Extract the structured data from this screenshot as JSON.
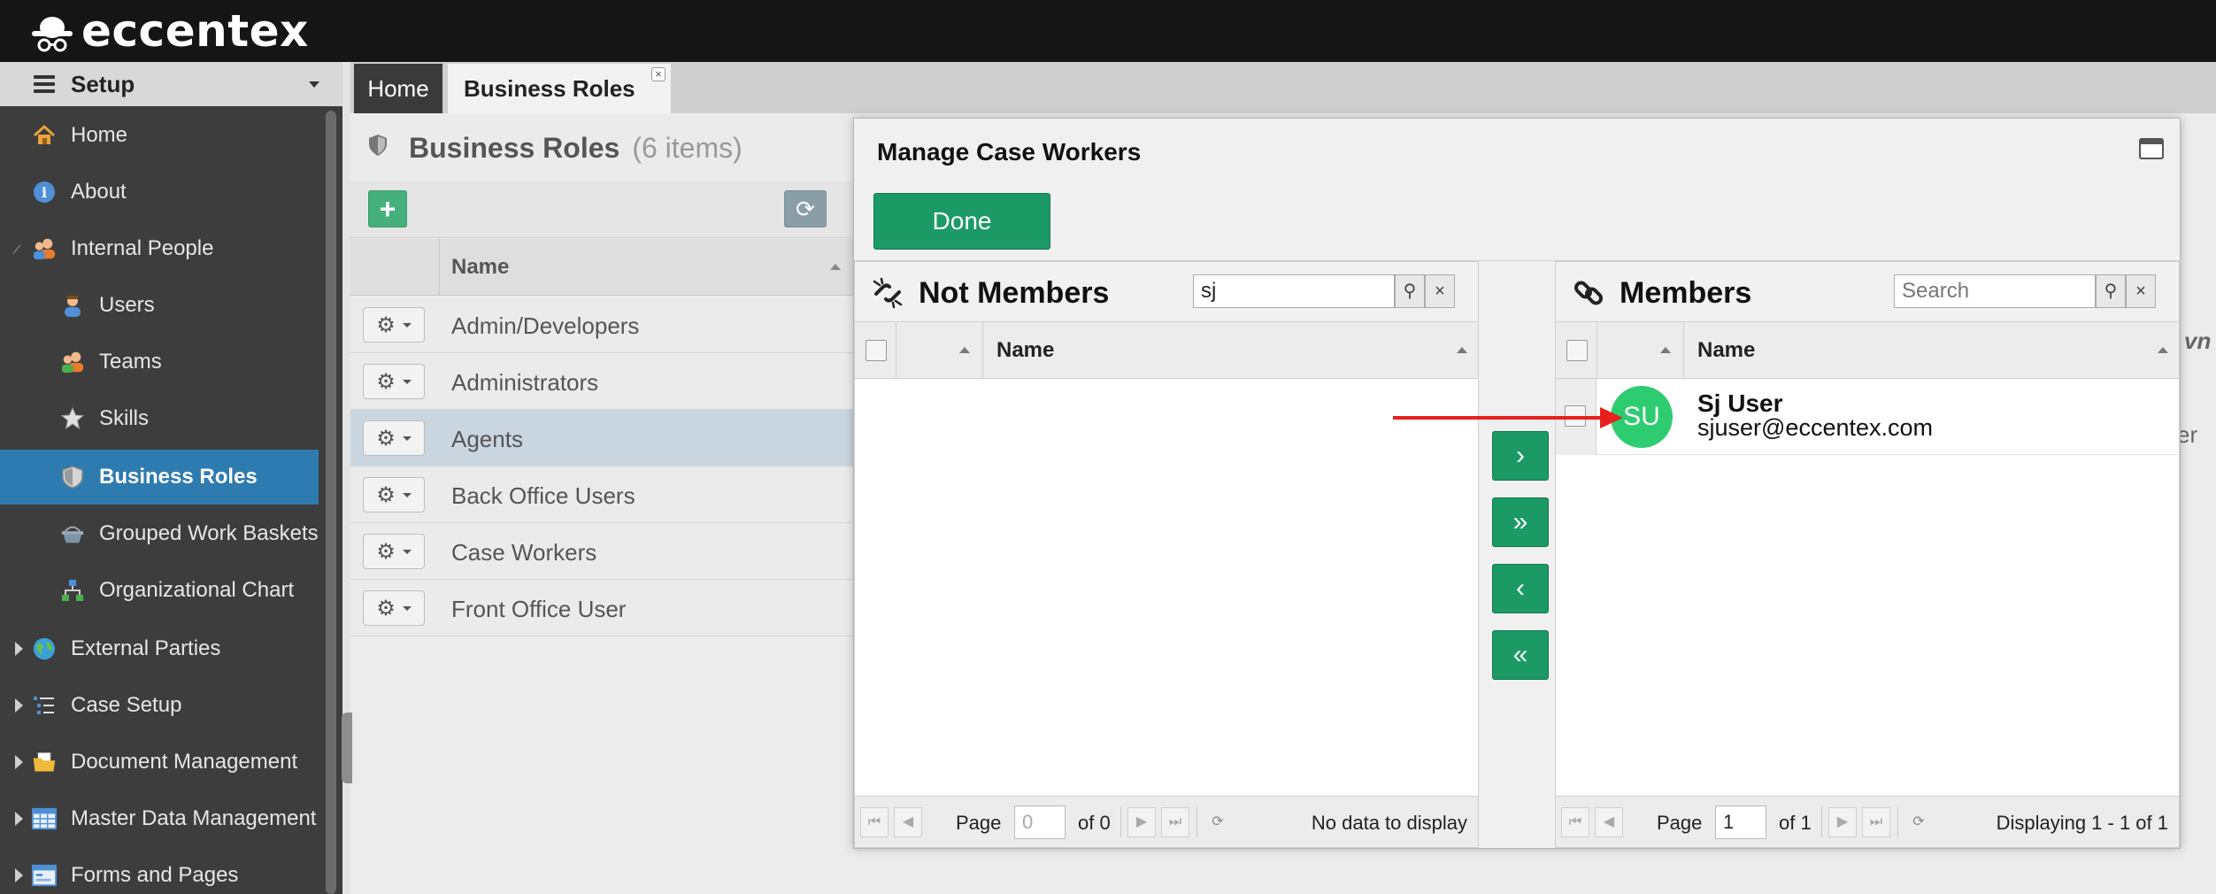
{
  "app": {
    "brand": "eccentex"
  },
  "sidebar": {
    "header": "Setup",
    "items": [
      {
        "label": "Home",
        "icon": "house-icon"
      },
      {
        "label": "About",
        "icon": "info-icon"
      },
      {
        "label": "Internal People",
        "icon": "people-icon"
      },
      {
        "label": "Users",
        "icon": "user-icon"
      },
      {
        "label": "Teams",
        "icon": "team-icon"
      },
      {
        "label": "Skills",
        "icon": "star-icon"
      },
      {
        "label": "Business Roles",
        "icon": "shield-icon"
      },
      {
        "label": "Grouped Work Baskets",
        "icon": "basket-icon"
      },
      {
        "label": "Organizational Chart",
        "icon": "org-chart-icon"
      },
      {
        "label": "External Parties",
        "icon": "globe-icon"
      },
      {
        "label": "Case Setup",
        "icon": "case-setup-icon"
      },
      {
        "label": "Document Management",
        "icon": "folder-icon"
      },
      {
        "label": "Master Data Management",
        "icon": "table-icon"
      },
      {
        "label": "Forms and Pages",
        "icon": "form-icon"
      }
    ]
  },
  "tabs": [
    {
      "label": "Home"
    },
    {
      "label": "Business Roles"
    }
  ],
  "roles_panel": {
    "title": "Business Roles",
    "count": "(6 items)",
    "column_name": "Name",
    "rows": [
      {
        "name": "Admin/Developers"
      },
      {
        "name": "Administrators"
      },
      {
        "name": "Agents"
      },
      {
        "name": "Back Office Users"
      },
      {
        "name": "Case Workers"
      },
      {
        "name": "Front Office User"
      }
    ],
    "selected_row": "Agents"
  },
  "right_ghost": {
    "text1": "vn",
    "text2": "er"
  },
  "modal": {
    "title": "Manage Case Workers",
    "done_label": "Done",
    "not_members": {
      "title": "Not Members",
      "search_value": "sj",
      "column_name": "Name",
      "pager": {
        "page_label": "Page",
        "page_value": "0",
        "of_label": "of 0",
        "status": "No data to display"
      }
    },
    "members": {
      "title": "Members",
      "search_placeholder": "Search",
      "column_name": "Name",
      "rows": [
        {
          "initials": "SU",
          "name": "Sj User",
          "email": "sjuser@eccentex.com",
          "avatar_color": "#2ecc71"
        }
      ],
      "pager": {
        "page_label": "Page",
        "page_value": "1",
        "of_label": "of 1",
        "status": "Displaying 1 - 1 of 1"
      }
    },
    "movers": [
      "›",
      "»",
      "‹",
      "«"
    ]
  },
  "colors": {
    "accent_green": "#1c9a66",
    "active_nav": "#2e7bb0",
    "annotation_arrow": "#e8201c"
  }
}
